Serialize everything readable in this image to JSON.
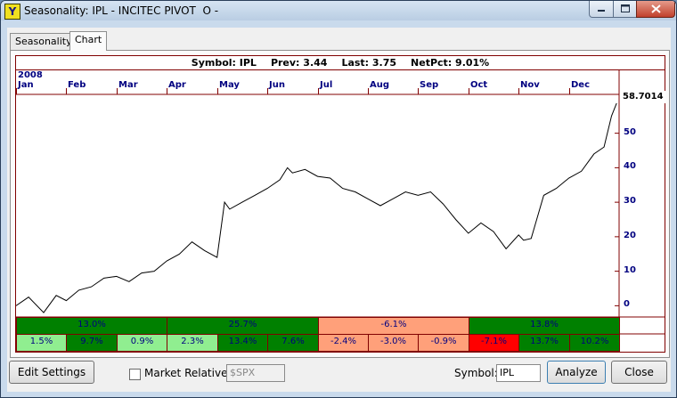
{
  "window": {
    "title": "Seasonality: IPL - INCITEC PIVOT  O -",
    "icon": "app-logo-icon"
  },
  "tabs": [
    {
      "label": "Seasonality",
      "active": false
    },
    {
      "label": "Chart",
      "active": true
    }
  ],
  "info": {
    "symbol": "Symbol: IPL",
    "prev": "Prev: 3.44",
    "last": "Last: 3.75",
    "netpct": "NetPct: 9.01%"
  },
  "chart_data": {
    "type": "line",
    "year": "2008",
    "months": [
      "Jan",
      "Feb",
      "Mar",
      "Apr",
      "May",
      "Jun",
      "Jul",
      "Aug",
      "Sep",
      "Oct",
      "Nov",
      "Dec"
    ],
    "y_ticks": [
      "50",
      "40",
      "30",
      "20",
      "10",
      "0"
    ],
    "last_value": "58.7014",
    "ylim": [
      -3,
      61
    ],
    "x": [
      0.0,
      0.25,
      0.55,
      0.8,
      1.0,
      1.25,
      1.5,
      1.75,
      2.0,
      2.25,
      2.5,
      2.75,
      3.0,
      3.25,
      3.5,
      3.75,
      4.0,
      4.15,
      4.25,
      4.5,
      4.75,
      5.0,
      5.25,
      5.4,
      5.5,
      5.75,
      6.0,
      6.25,
      6.5,
      6.75,
      7.0,
      7.25,
      7.5,
      7.75,
      8.0,
      8.25,
      8.5,
      8.75,
      9.0,
      9.25,
      9.5,
      9.75,
      10.0,
      10.1,
      10.25,
      10.5,
      10.75,
      11.0,
      11.25,
      11.5,
      11.7,
      11.85,
      11.95
    ],
    "y": [
      0.0,
      2.5,
      -2.0,
      3.0,
      1.5,
      4.5,
      5.5,
      8.0,
      8.5,
      7.0,
      9.5,
      10.0,
      13.0,
      15.0,
      18.5,
      16.0,
      14.0,
      30.0,
      28.0,
      30.0,
      32.0,
      34.0,
      36.5,
      40.0,
      38.5,
      39.5,
      37.5,
      37.0,
      34.0,
      33.0,
      31.0,
      29.0,
      31.0,
      33.0,
      32.0,
      33.0,
      29.5,
      25.0,
      21.0,
      24.0,
      21.5,
      16.5,
      20.5,
      19.0,
      19.5,
      32.0,
      34.0,
      37.0,
      39.0,
      44.0,
      46.0,
      55.0,
      58.7
    ]
  },
  "monthly_returns": [
    {
      "month": "Jan",
      "value": "1.5%",
      "color": "#90ee90"
    },
    {
      "month": "Feb",
      "value": "9.7%",
      "color": "#008000"
    },
    {
      "month": "Mar",
      "value": "0.9%",
      "color": "#90ee90"
    },
    {
      "month": "Apr",
      "value": "2.3%",
      "color": "#90ee90"
    },
    {
      "month": "May",
      "value": "13.4%",
      "color": "#008000"
    },
    {
      "month": "Jun",
      "value": "7.6%",
      "color": "#008000"
    },
    {
      "month": "Jul",
      "value": "-2.4%",
      "color": "#ffa07a"
    },
    {
      "month": "Aug",
      "value": "-3.0%",
      "color": "#ffa07a"
    },
    {
      "month": "Sep",
      "value": "-0.9%",
      "color": "#ffa07a"
    },
    {
      "month": "Oct",
      "value": "-7.1%",
      "color": "#ff0000"
    },
    {
      "month": "Nov",
      "value": "13.7%",
      "color": "#008000"
    },
    {
      "month": "Dec",
      "value": "10.2%",
      "color": "#008000"
    }
  ],
  "quarterly_returns": [
    {
      "quarter": "Q1",
      "value": "13.0%",
      "color": "#008000"
    },
    {
      "quarter": "Q2",
      "value": "25.7%",
      "color": "#008000"
    },
    {
      "quarter": "Q3",
      "value": "-6.1%",
      "color": "#ffa07a"
    },
    {
      "quarter": "Q4",
      "value": "13.8%",
      "color": "#008000"
    }
  ],
  "controls": {
    "edit_settings": "Edit Settings",
    "market_relative_label": "Market Relative:",
    "market_relative_checked": false,
    "market_relative_value": "$SPX",
    "symbol_label": "Symbol:",
    "symbol_value": "IPL",
    "analyze": "Analyze",
    "close": "Close"
  }
}
